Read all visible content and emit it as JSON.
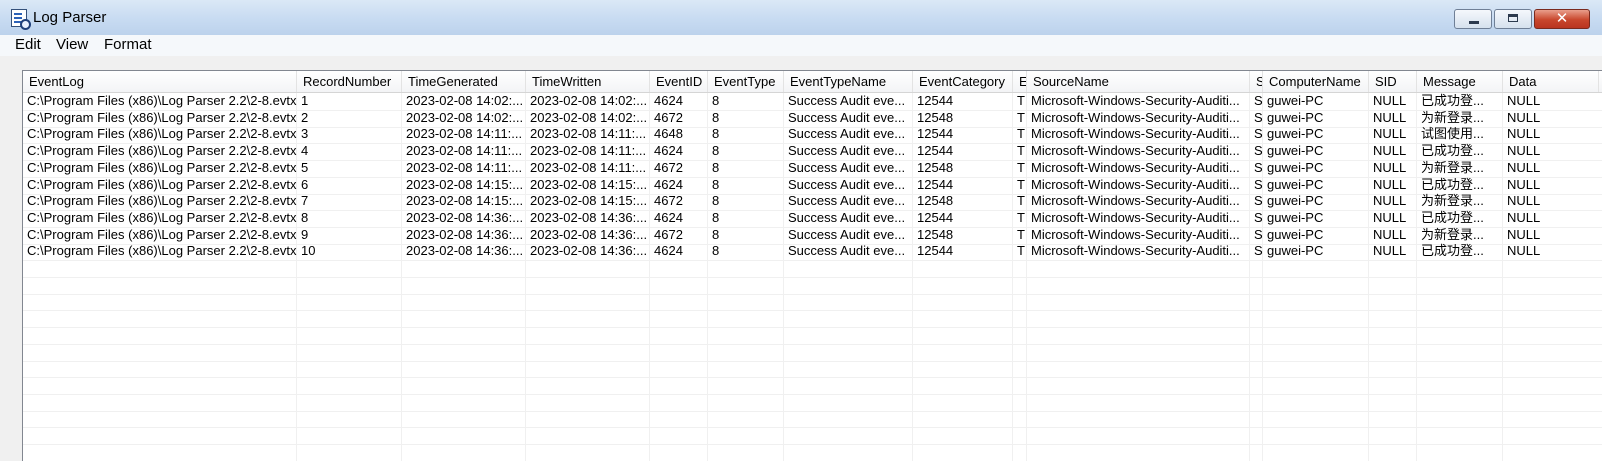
{
  "window": {
    "title": "Log Parser",
    "icon": "log-parser-icon",
    "controls": {
      "minimize": "minimize-icon",
      "maximize": "maximize-icon",
      "close": "close-icon"
    }
  },
  "menu": {
    "items": [
      "Edit",
      "View",
      "Format"
    ]
  },
  "table": {
    "columns": [
      "EventLog",
      "RecordNumber",
      "TimeGenerated",
      "TimeWritten",
      "EventID",
      "EventType",
      "EventTypeName",
      "EventCategory",
      "E",
      "SourceName",
      "S",
      "ComputerName",
      "SID",
      "Message",
      "Data"
    ],
    "rows": [
      [
        "C:\\Program Files (x86)\\Log Parser 2.2\\2-8.evtx",
        "1",
        "2023-02-08 14:02:...",
        "2023-02-08 14:02:...",
        "4624",
        "8",
        "Success Audit eve...",
        "12544",
        "T",
        "Microsoft-Windows-Security-Auditi...",
        "S",
        "guwei-PC",
        "NULL",
        "已成功登...",
        "NULL"
      ],
      [
        "C:\\Program Files (x86)\\Log Parser 2.2\\2-8.evtx",
        "2",
        "2023-02-08 14:02:...",
        "2023-02-08 14:02:...",
        "4672",
        "8",
        "Success Audit eve...",
        "12548",
        "T",
        "Microsoft-Windows-Security-Auditi...",
        "S",
        "guwei-PC",
        "NULL",
        "为新登录...",
        "NULL"
      ],
      [
        "C:\\Program Files (x86)\\Log Parser 2.2\\2-8.evtx",
        "3",
        "2023-02-08 14:11:...",
        "2023-02-08 14:11:...",
        "4648",
        "8",
        "Success Audit eve...",
        "12544",
        "T",
        "Microsoft-Windows-Security-Auditi...",
        "S",
        "guwei-PC",
        "NULL",
        "试图使用...",
        "NULL"
      ],
      [
        "C:\\Program Files (x86)\\Log Parser 2.2\\2-8.evtx",
        "4",
        "2023-02-08 14:11:...",
        "2023-02-08 14:11:...",
        "4624",
        "8",
        "Success Audit eve...",
        "12544",
        "T",
        "Microsoft-Windows-Security-Auditi...",
        "S",
        "guwei-PC",
        "NULL",
        "已成功登...",
        "NULL"
      ],
      [
        "C:\\Program Files (x86)\\Log Parser 2.2\\2-8.evtx",
        "5",
        "2023-02-08 14:11:...",
        "2023-02-08 14:11:...",
        "4672",
        "8",
        "Success Audit eve...",
        "12548",
        "T",
        "Microsoft-Windows-Security-Auditi...",
        "S",
        "guwei-PC",
        "NULL",
        "为新登录...",
        "NULL"
      ],
      [
        "C:\\Program Files (x86)\\Log Parser 2.2\\2-8.evtx",
        "6",
        "2023-02-08 14:15:...",
        "2023-02-08 14:15:...",
        "4624",
        "8",
        "Success Audit eve...",
        "12544",
        "T",
        "Microsoft-Windows-Security-Auditi...",
        "S",
        "guwei-PC",
        "NULL",
        "已成功登...",
        "NULL"
      ],
      [
        "C:\\Program Files (x86)\\Log Parser 2.2\\2-8.evtx",
        "7",
        "2023-02-08 14:15:...",
        "2023-02-08 14:15:...",
        "4672",
        "8",
        "Success Audit eve...",
        "12548",
        "T",
        "Microsoft-Windows-Security-Auditi...",
        "S",
        "guwei-PC",
        "NULL",
        "为新登录...",
        "NULL"
      ],
      [
        "C:\\Program Files (x86)\\Log Parser 2.2\\2-8.evtx",
        "8",
        "2023-02-08 14:36:...",
        "2023-02-08 14:36:...",
        "4624",
        "8",
        "Success Audit eve...",
        "12544",
        "T",
        "Microsoft-Windows-Security-Auditi...",
        "S",
        "guwei-PC",
        "NULL",
        "已成功登...",
        "NULL"
      ],
      [
        "C:\\Program Files (x86)\\Log Parser 2.2\\2-8.evtx",
        "9",
        "2023-02-08 14:36:...",
        "2023-02-08 14:36:...",
        "4672",
        "8",
        "Success Audit eve...",
        "12548",
        "T",
        "Microsoft-Windows-Security-Auditi...",
        "S",
        "guwei-PC",
        "NULL",
        "为新登录...",
        "NULL"
      ],
      [
        "C:\\Program Files (x86)\\Log Parser 2.2\\2-8.evtx",
        "10",
        "2023-02-08 14:36:...",
        "2023-02-08 14:36:...",
        "4624",
        "8",
        "Success Audit eve...",
        "12544",
        "T",
        "Microsoft-Windows-Security-Auditi...",
        "S",
        "guwei-PC",
        "NULL",
        "已成功登...",
        "NULL"
      ]
    ]
  }
}
